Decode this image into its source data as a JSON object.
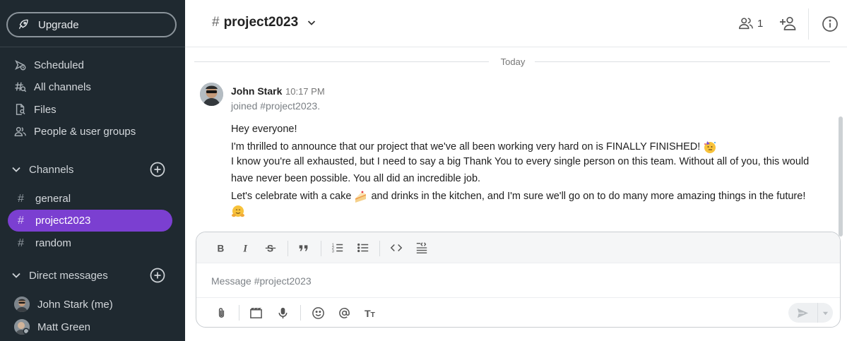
{
  "sidebar": {
    "upgrade_label": "Upgrade",
    "nav": [
      {
        "label": "Scheduled",
        "icon": "scheduled-icon"
      },
      {
        "label": "All channels",
        "icon": "hash-search-icon"
      },
      {
        "label": "Files",
        "icon": "file-search-icon"
      },
      {
        "label": "People & user groups",
        "icon": "people-icon"
      }
    ],
    "channels_header": "Channels",
    "channels": [
      {
        "name": "general",
        "active": false
      },
      {
        "name": "project2023",
        "active": true
      },
      {
        "name": "random",
        "active": false
      }
    ],
    "dm_header": "Direct messages",
    "dms": [
      {
        "name": "John Stark (me)"
      },
      {
        "name": "Matt Green"
      }
    ]
  },
  "header": {
    "channel_name": "project2023",
    "hash": "#",
    "member_count": "1"
  },
  "messages": {
    "day_divider": "Today",
    "author": "John Stark",
    "time": "10:17 PM",
    "joined_text": "joined #project2023.",
    "lines": [
      "Hey everyone!",
      "I'm thrilled to announce that our project that we've all been working very hard on is FINALLY FINISHED!",
      "I know you're all exhausted, but I need to say a big Thank You to every single person on this team. Without all of you, this would",
      "have never been possible. You all did an incredible job.",
      "Let's celebrate with a cake",
      "and drinks in the kitchen, and I'm sure we'll go on to do many more amazing things in the future!"
    ]
  },
  "composer": {
    "placeholder": "Message #project2023"
  },
  "colors": {
    "sidebar_bg": "#1f2930",
    "active_channel": "#7b3fd1"
  }
}
